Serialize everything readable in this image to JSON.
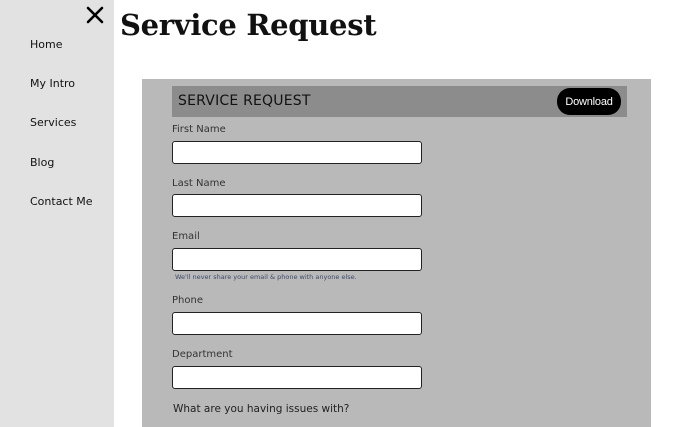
{
  "sidebar": {
    "close_icon": "close-icon",
    "items": [
      {
        "label": "Home"
      },
      {
        "label": "My Intro"
      },
      {
        "label": "Services"
      },
      {
        "label": "Blog"
      },
      {
        "label": "Contact Me"
      }
    ]
  },
  "page": {
    "title": "Service Request"
  },
  "form": {
    "header_title": "SERVICE REQUEST",
    "download_label": "Download",
    "fields": {
      "first_name": {
        "label": "First Name",
        "value": ""
      },
      "last_name": {
        "label": "Last Name",
        "value": ""
      },
      "email": {
        "label": "Email",
        "value": "",
        "hint": "We'll never share your email & phone with anyone else."
      },
      "phone": {
        "label": "Phone",
        "value": ""
      },
      "department": {
        "label": "Department",
        "value": ""
      }
    },
    "question": "What are you having issues with?"
  },
  "colors": {
    "sidebar_bg": "#e2e2e2",
    "panel_bg": "#b9b9b9",
    "header_bg": "#8c8c8c",
    "button_bg": "#000000"
  }
}
